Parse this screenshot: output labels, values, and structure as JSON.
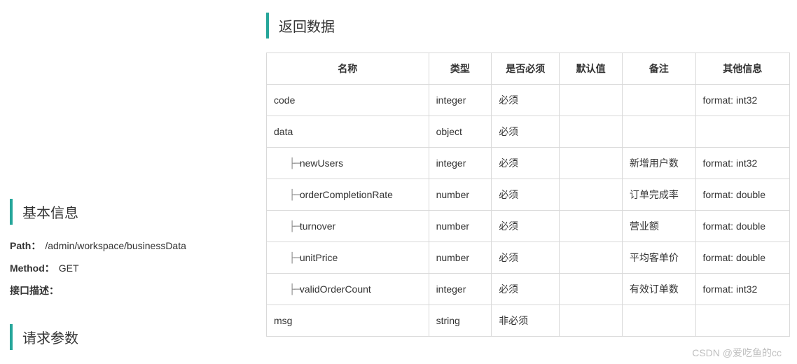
{
  "left": {
    "basic_info_title": "基本信息",
    "path_label": "Path：",
    "path_value": "/admin/workspace/businessData",
    "method_label": "Method：",
    "method_value": "GET",
    "desc_label": "接口描述：",
    "request_params_title": "请求参数"
  },
  "right": {
    "return_data_title": "返回数据",
    "headers": [
      "名称",
      "类型",
      "是否必须",
      "默认值",
      "备注",
      "其他信息"
    ],
    "rows": [
      {
        "indent": 0,
        "name": "code",
        "type": "integer",
        "required": "必须",
        "default": "",
        "remark": "",
        "other": "format: int32"
      },
      {
        "indent": 0,
        "name": "data",
        "type": "object",
        "required": "必须",
        "default": "",
        "remark": "",
        "other": ""
      },
      {
        "indent": 1,
        "name": "newUsers",
        "type": "integer",
        "required": "必须",
        "default": "",
        "remark": "新增用户数",
        "other": "format: int32"
      },
      {
        "indent": 1,
        "name": "orderCompletionRate",
        "type": "number",
        "required": "必须",
        "default": "",
        "remark": "订单完成率",
        "other": "format: double"
      },
      {
        "indent": 1,
        "name": "turnover",
        "type": "number",
        "required": "必须",
        "default": "",
        "remark": "营业额",
        "other": "format: double"
      },
      {
        "indent": 1,
        "name": "unitPrice",
        "type": "number",
        "required": "必须",
        "default": "",
        "remark": "平均客单价",
        "other": "format: double"
      },
      {
        "indent": 1,
        "name": "validOrderCount",
        "type": "integer",
        "required": "必须",
        "default": "",
        "remark": "有效订单数",
        "other": "format: int32"
      },
      {
        "indent": 0,
        "name": "msg",
        "type": "string",
        "required": "非必须",
        "default": "",
        "remark": "",
        "other": ""
      }
    ]
  },
  "watermark": "CSDN @爱吃鱼的cc"
}
